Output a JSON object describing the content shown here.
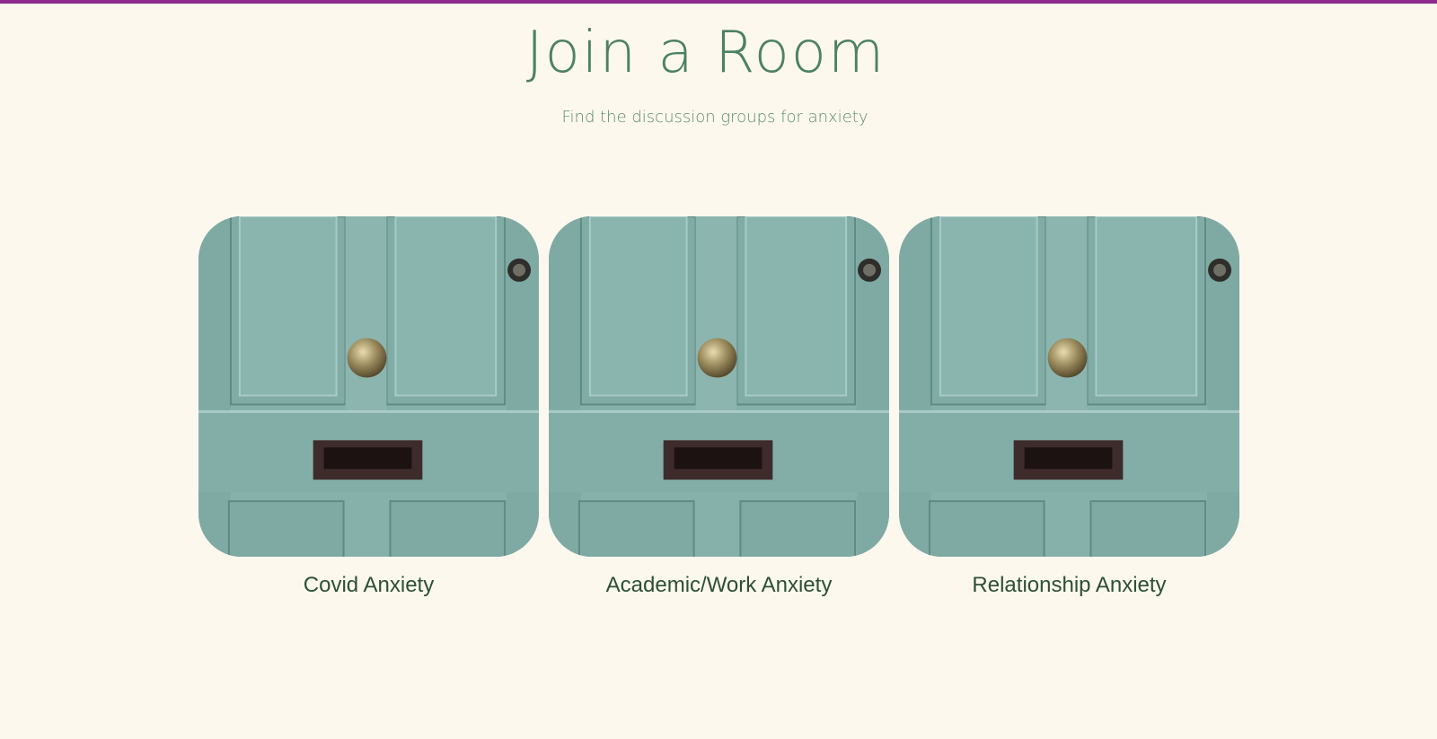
{
  "header": {
    "title": "Join a Room",
    "subtitle": "Find the discussion groups for anxiety"
  },
  "rooms": [
    {
      "label": "Covid Anxiety",
      "image": "teal-door-image"
    },
    {
      "label": "Academic/Work Anxiety",
      "image": "teal-door-image"
    },
    {
      "label": "Relationship Anxiety",
      "image": "teal-door-image"
    }
  ],
  "colors": {
    "background": "#fdf8ee",
    "top_rule": "#8e2a8e",
    "title": "#4d8163",
    "label": "#2c4f38",
    "door": "#86b0aa"
  }
}
